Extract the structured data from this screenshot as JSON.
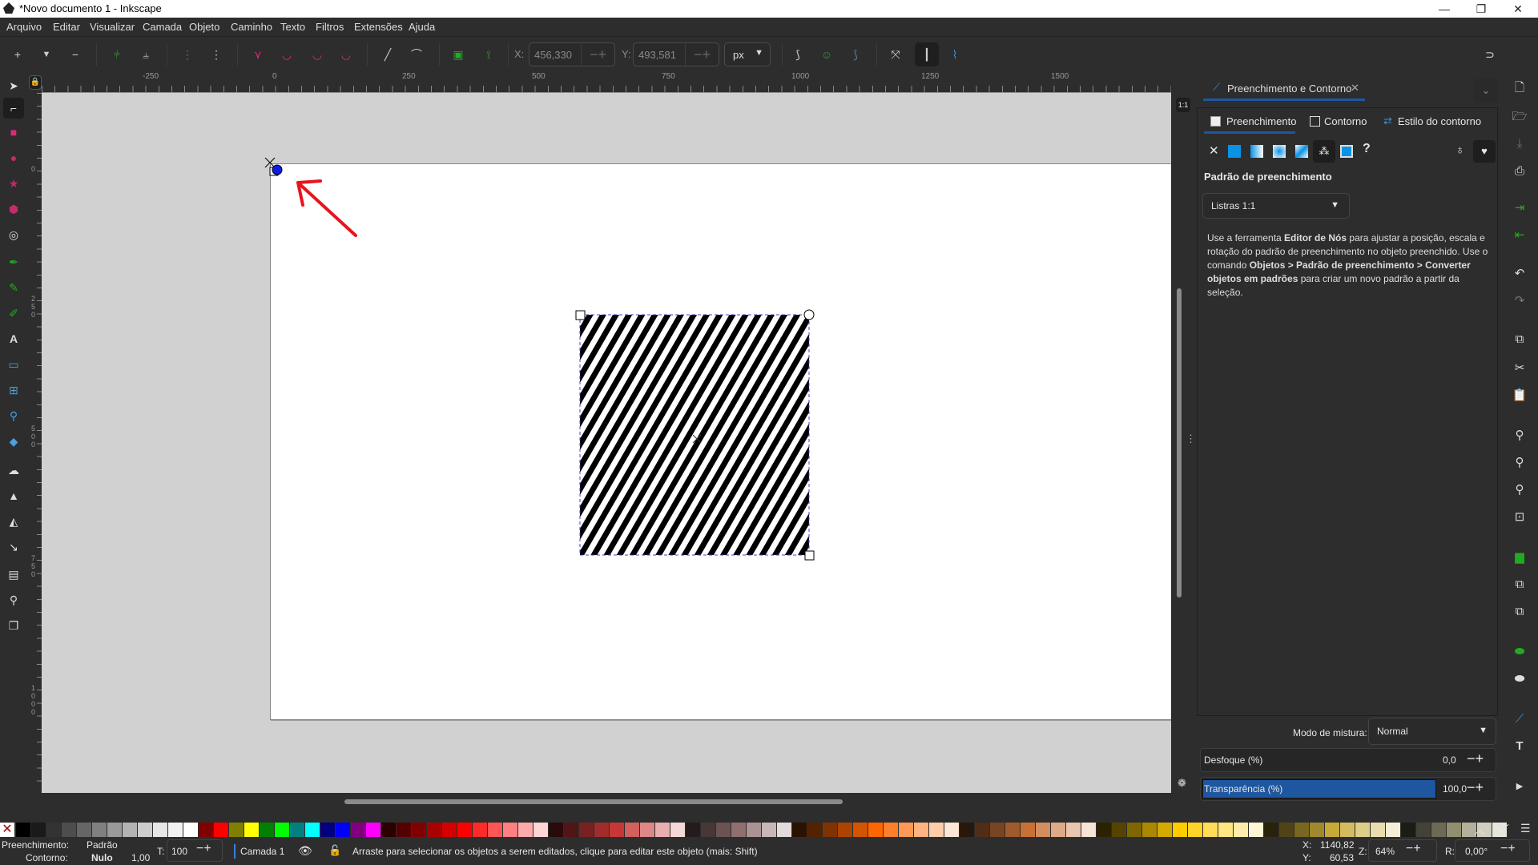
{
  "window": {
    "title": "*Novo documento 1 - Inkscape",
    "controls": [
      "minimize",
      "maximize",
      "close"
    ]
  },
  "menubar": {
    "items": [
      "Arquivo",
      "Editar",
      "Visualizar",
      "Camada",
      "Objeto",
      "Caminho",
      "Texto",
      "Filtros",
      "Extensões",
      "Ajuda"
    ]
  },
  "toolbar": {
    "x_label": "X:",
    "x_value": "456,330",
    "y_label": "Y:",
    "y_value": "493,581",
    "unit": "px",
    "icons": [
      "insert-node-icon",
      "insert-options-icon",
      "delete-node-icon",
      "join-nodes-icon",
      "break-path-icon",
      "join-segment-icon",
      "delete-segment-icon",
      "node-cusp-icon",
      "node-smooth-icon",
      "node-symmetric-icon",
      "node-auto-icon",
      "segment-line-icon",
      "segment-curve-icon",
      "object-to-path-icon",
      "stroke-to-path-icon",
      "path-effect-icon",
      "clip-path-icon",
      "mask-icon",
      "transform-handles-icon",
      "show-handles-icon",
      "show-outline-icon"
    ]
  },
  "ruler": {
    "top_labels": [
      "-250",
      "0",
      "250",
      "500",
      "750",
      "1000",
      "1250",
      "1500"
    ],
    "left_labels": [
      "0",
      "250",
      "500",
      "750",
      "1000"
    ],
    "zoom_1_1": "1:1"
  },
  "left_tools": [
    "selector-icon",
    "node-tool-icon",
    "rect-tool-icon",
    "ellipse-tool-icon",
    "star-tool-icon",
    "3dbox-tool-icon",
    "spiral-tool-icon",
    "pen-tool-icon",
    "pencil-tool-icon",
    "calligraphy-tool-icon",
    "text-tool-icon",
    "gradient-tool-icon",
    "mesh-tool-icon",
    "dropper-tool-icon",
    "paint-bucket-icon",
    "tweak-tool-icon",
    "spray-tool-icon",
    "eraser-tool-icon",
    "connector-tool-icon",
    "page-tool-icon",
    "zoom-tool-icon",
    "pages-icon"
  ],
  "panel": {
    "tab_title": "Preenchimento e Contorno",
    "subtabs": [
      "Preenchimento",
      "Contorno",
      "Estilo do contorno"
    ],
    "paint_types": [
      "none",
      "flat",
      "linear",
      "radial",
      "mesh",
      "pattern",
      "swatch",
      "unset"
    ],
    "section_title": "Padrão de preenchimento",
    "pattern_select": "Listras 1:1",
    "help_parts": [
      {
        "t": "Use a ferramenta ",
        "b": false
      },
      {
        "t": "Editor de Nós",
        "b": true
      },
      {
        "t": " para ajustar a posição, escala e rotação do padrão de preenchimento no objeto preenchido. Use o comando ",
        "b": false
      },
      {
        "t": "Objetos > Padrão de preenchimento > Converter objetos em padrões",
        "b": true
      },
      {
        "t": " para criar um novo padrão a partir da seleção.",
        "b": false
      }
    ],
    "blend_label": "Modo de mistura:",
    "blend_value": "Normal",
    "blur_label": "Desfoque (%)",
    "blur_value": "0,0",
    "opacity_label": "Transparência (%)",
    "opacity_value": "100,0",
    "opacity_percent": 100
  },
  "status": {
    "fill_label": "Preenchimento:",
    "fill_value": "Padrão",
    "stroke_label": "Contorno:",
    "stroke_value": "Nulo",
    "stroke_width": "1,00",
    "opacity_label": "T:",
    "opacity_value": "100",
    "layer": "Camada 1",
    "message": "Arraste para selecionar os objetos a serem editados, clique para editar este objeto (mais: Shift)",
    "x_label": "X:",
    "x_value": "1140,82",
    "y_label": "Y:",
    "y_value": "60,53",
    "zoom_label": "Z:",
    "zoom_value": "64%",
    "rotation_label": "R:",
    "rotation_value": "0,00°"
  },
  "palette": [
    "#000000",
    "#1a1a1a",
    "#333333",
    "#4d4d4d",
    "#666666",
    "#808080",
    "#999999",
    "#b3b3b3",
    "#cccccc",
    "#e6e6e6",
    "#f2f2f2",
    "#ffffff",
    "#800000",
    "#ff0000",
    "#808000",
    "#ffff00",
    "#008000",
    "#00ff00",
    "#008080",
    "#00ffff",
    "#000080",
    "#0000ff",
    "#800080",
    "#ff00ff",
    "#2b0000",
    "#550000",
    "#800000",
    "#aa0000",
    "#d40000",
    "#ff0000",
    "#ff2a2a",
    "#ff5555",
    "#ff8080",
    "#ffaaaa",
    "#ffd5d5",
    "#280b0b",
    "#501616",
    "#782121",
    "#a02c2c",
    "#c83737",
    "#d35f5f",
    "#de8787",
    "#e9afaf",
    "#f4d7d7",
    "#241c1c",
    "#483737",
    "#6c5353",
    "#916f6f",
    "#ac9393",
    "#c8b7b7",
    "#e3dbdb",
    "#2b1100",
    "#552200",
    "#803300",
    "#aa4400",
    "#d45500",
    "#ff6600",
    "#ff7f2a",
    "#ff9955",
    "#ffb380",
    "#ffccaa",
    "#ffe6d5",
    "#28170b",
    "#502d16",
    "#784421",
    "#a05a2c",
    "#c87137",
    "#d38d5f",
    "#deaa87",
    "#e9c6af",
    "#f4e3d7",
    "#2b2200",
    "#554400",
    "#806600",
    "#aa8800",
    "#d4aa00",
    "#ffcc00",
    "#ffd42a",
    "#ffdd55",
    "#ffe680",
    "#ffeeaa",
    "#fff6d5",
    "#28220b",
    "#504416",
    "#786721",
    "#a0892c",
    "#c8ab37",
    "#d3bc5f",
    "#decd87",
    "#e9ddaf",
    "#f4eed7",
    "#1c1c17",
    "#434237",
    "#6c6a53",
    "#918f6f",
    "#b3b19a",
    "#d0cfbf",
    "#e8e7dd"
  ]
}
